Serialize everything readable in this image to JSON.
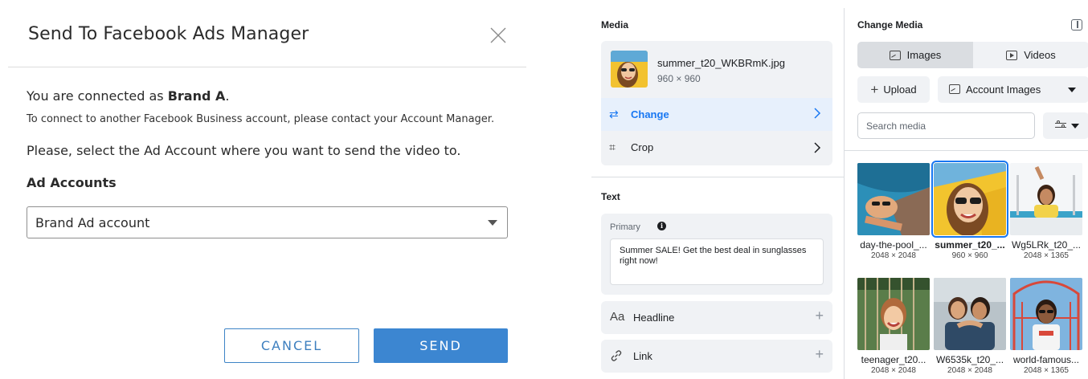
{
  "dialog": {
    "title": "Send To Facebook Ads Manager",
    "connected_prefix": "You are connected as ",
    "connected_brand": "Brand A",
    "connected_suffix": ".",
    "contact_note": "To connect to another Facebook Business account, please contact your Account Manager.",
    "instruction": "Please, select the Ad Account where you want to send the video to.",
    "ad_accounts_label": "Ad Accounts",
    "ad_account_selected": "Brand Ad account",
    "cancel_label": "CANCEL",
    "send_label": "SEND"
  },
  "media_panel": {
    "media_heading": "Media",
    "file_name": "summer_t20_WKBRmK.jpg",
    "file_dims": "960 × 960",
    "change_label": "Change",
    "crop_label": "Crop",
    "text_heading": "Text",
    "primary_label": "Primary",
    "primary_text": "Summer SALE! Get the best deal in sunglasses right now!",
    "headline_label": "Headline",
    "headline_icon_text": "Aa",
    "link_label": "Link"
  },
  "change_media": {
    "title": "Change Media",
    "tabs": [
      {
        "label": "Images",
        "active": true,
        "icon": "image-icon"
      },
      {
        "label": "Videos",
        "active": false,
        "icon": "video-icon"
      }
    ],
    "upload_label": "Upload",
    "account_images_label": "Account Images",
    "search_placeholder": "Search media",
    "images": [
      {
        "name": "day-the-pool_...",
        "dims": "2048 × 2048",
        "selected": false
      },
      {
        "name": "summer_t20_...",
        "dims": "960 × 960",
        "selected": true
      },
      {
        "name": "Wg5LRk_t20_...",
        "dims": "2048 × 1365",
        "selected": false
      },
      {
        "name": "teenager_t20...",
        "dims": "2048 × 2048",
        "selected": false
      },
      {
        "name": "W6535k_t20_...",
        "dims": "2048 × 2048",
        "selected": false
      },
      {
        "name": "world-famous...",
        "dims": "2048 × 1365",
        "selected": false
      }
    ]
  },
  "colors": {
    "accent_blue": "#3c86d1",
    "facebook_blue": "#1877f2",
    "panel_gray": "#f0f2f5"
  }
}
